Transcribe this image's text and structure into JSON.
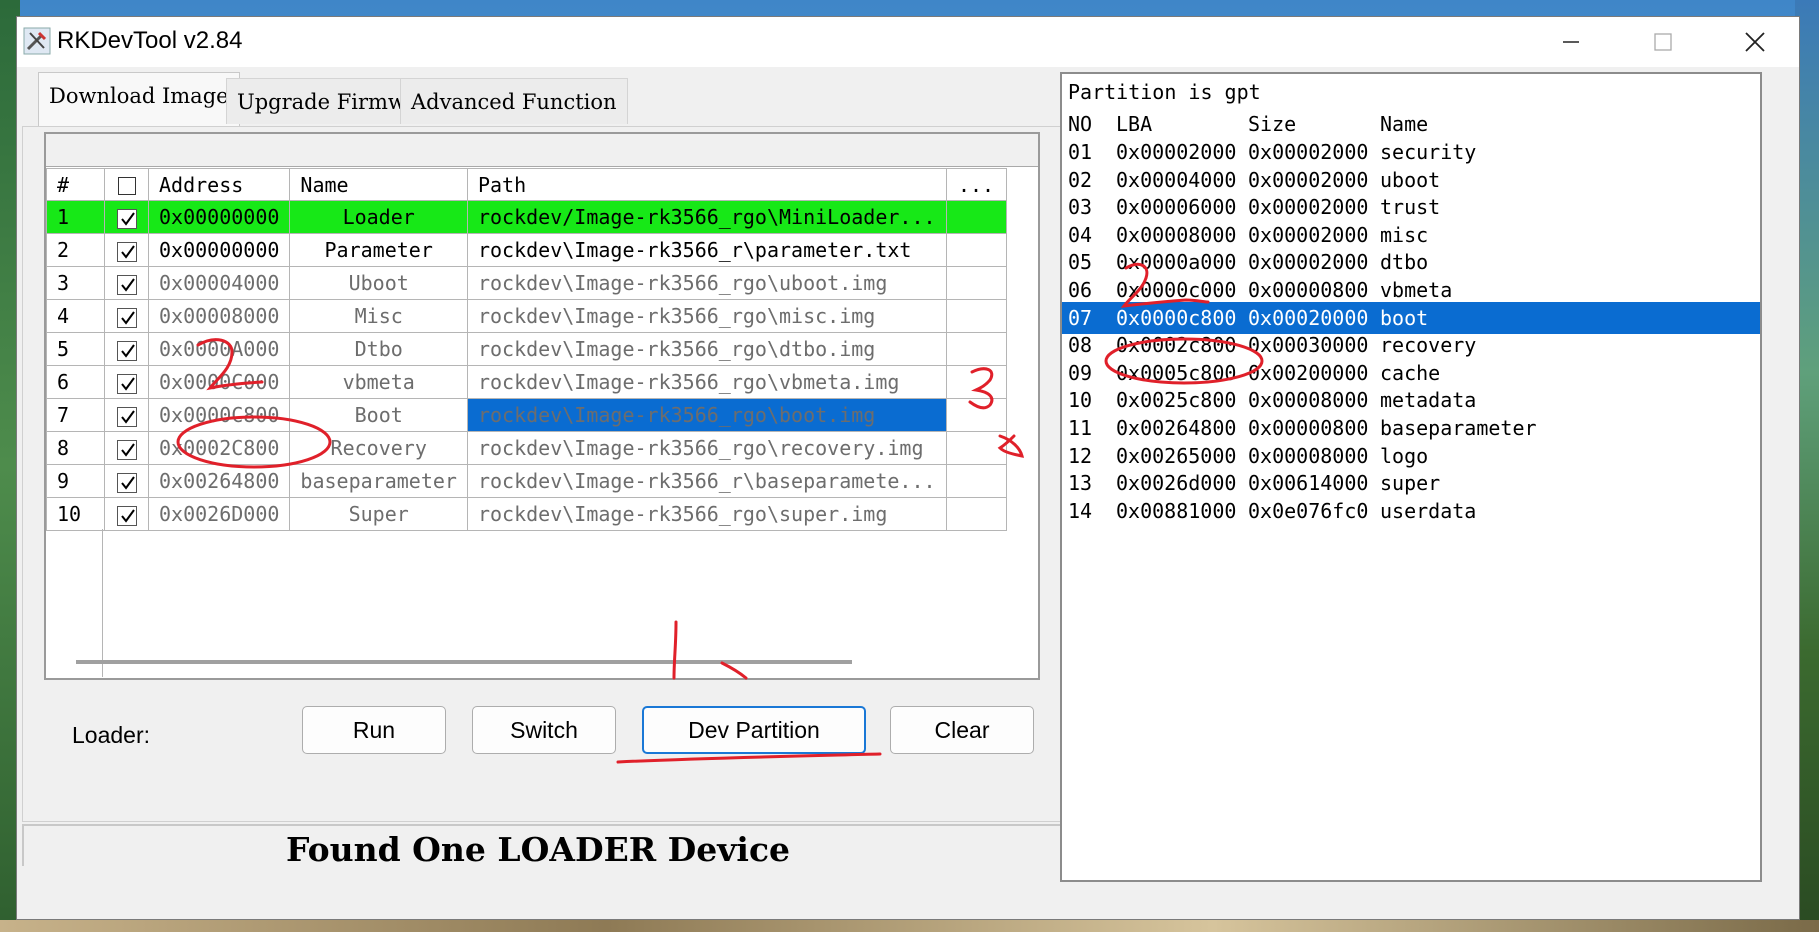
{
  "window": {
    "title": "RKDevTool v2.84"
  },
  "tabs": [
    "Download Image",
    "Upgrade Firmware",
    "Advanced Function"
  ],
  "grid": {
    "headers": [
      "#",
      "",
      "Address",
      "Name",
      "Path",
      "..."
    ],
    "rows": [
      {
        "idx": "1",
        "address": "0x00000000",
        "name": "Loader",
        "path": "rockdev/Image-rk3566_rgo\\MiniLoader..."
      },
      {
        "idx": "2",
        "address": "0x00000000",
        "name": "Parameter",
        "path": "rockdev\\Image-rk3566_r\\parameter.txt"
      },
      {
        "idx": "3",
        "address": "0x00004000",
        "name": "Uboot",
        "path": "rockdev\\Image-rk3566_rgo\\uboot.img"
      },
      {
        "idx": "4",
        "address": "0x00008000",
        "name": "Misc",
        "path": "rockdev\\Image-rk3566_rgo\\misc.img"
      },
      {
        "idx": "5",
        "address": "0x0000A000",
        "name": "Dtbo",
        "path": "rockdev\\Image-rk3566_rgo\\dtbo.img"
      },
      {
        "idx": "6",
        "address": "0x0000C000",
        "name": "vbmeta",
        "path": "rockdev\\Image-rk3566_rgo\\vbmeta.img"
      },
      {
        "idx": "7",
        "address": "0x0000C800",
        "name": "Boot",
        "path": "rockdev\\Image-rk3566_rgo\\boot.img"
      },
      {
        "idx": "8",
        "address": "0x0002C800",
        "name": "Recovery",
        "path": "rockdev\\Image-rk3566_rgo\\recovery.img"
      },
      {
        "idx": "9",
        "address": "0x00264800",
        "name": "baseparameter",
        "path": "rockdev\\Image-rk3566_r\\baseparamete..."
      },
      {
        "idx": "10",
        "address": "0x0026D000",
        "name": "Super",
        "path": "rockdev\\Image-rk3566_rgo\\super.img"
      }
    ]
  },
  "loader_label": "Loader:",
  "buttons": {
    "run": "Run",
    "switch": "Switch",
    "dev_partition": "Dev Partition",
    "clear": "Clear"
  },
  "status": "Found One LOADER Device",
  "partition": {
    "heading": "Partition is gpt",
    "columns": [
      "NO",
      "LBA",
      "Size",
      "Name"
    ],
    "rows": [
      {
        "no": "01",
        "lba": "0x00002000",
        "size": "0x00002000",
        "name": "security"
      },
      {
        "no": "02",
        "lba": "0x00004000",
        "size": "0x00002000",
        "name": "uboot"
      },
      {
        "no": "03",
        "lba": "0x00006000",
        "size": "0x00002000",
        "name": "trust"
      },
      {
        "no": "04",
        "lba": "0x00008000",
        "size": "0x00002000",
        "name": "misc"
      },
      {
        "no": "05",
        "lba": "0x0000a000",
        "size": "0x00002000",
        "name": "dtbo"
      },
      {
        "no": "06",
        "lba": "0x0000c000",
        "size": "0x00000800",
        "name": "vbmeta"
      },
      {
        "no": "07",
        "lba": "0x0000c800",
        "size": "0x00020000",
        "name": "boot"
      },
      {
        "no": "08",
        "lba": "0x0002c800",
        "size": "0x00030000",
        "name": "recovery"
      },
      {
        "no": "09",
        "lba": "0x0005c800",
        "size": "0x00200000",
        "name": "cache"
      },
      {
        "no": "10",
        "lba": "0x0025c800",
        "size": "0x00008000",
        "name": "metadata"
      },
      {
        "no": "11",
        "lba": "0x00264800",
        "size": "0x00000800",
        "name": "baseparameter"
      },
      {
        "no": "12",
        "lba": "0x00265000",
        "size": "0x00008000",
        "name": "logo"
      },
      {
        "no": "13",
        "lba": "0x0026d000",
        "size": "0x00614000",
        "name": "super"
      },
      {
        "no": "14",
        "lba": "0x00881000",
        "size": "0x0e076fc0",
        "name": "userdata"
      }
    ]
  },
  "colors": {
    "selection": "#0a6cd1",
    "loader_row": "#17e817",
    "annotation": "#e0202a"
  }
}
